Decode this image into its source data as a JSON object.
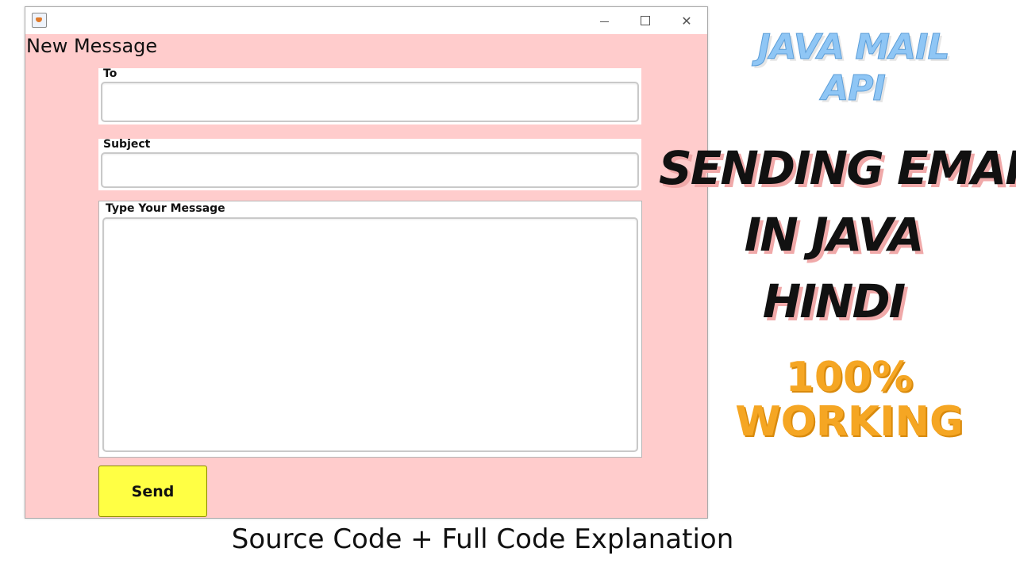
{
  "window": {
    "title": "New Message",
    "controls": {
      "minimize": "—",
      "maximize": "☐",
      "close": "✕"
    }
  },
  "form": {
    "to_label": "To",
    "to_value": "",
    "subject_label": "Subject",
    "subject_value": "",
    "message_label": "Type Your Message",
    "message_value": "",
    "send_label": "Send"
  },
  "promo": {
    "line1": "JAVA MAIL",
    "line2": "API",
    "line3": "SENDING EMAIL",
    "line4": "IN JAVA",
    "line5": "HINDI",
    "line6": "100%",
    "line7": "WORKING"
  },
  "caption": "Source Code + Full Code Explanation",
  "colors": {
    "window_background": "#ffcccc",
    "send_button": "#ffff44",
    "promo_blue": "#8fc6f5",
    "promo_orange": "#f5a623"
  }
}
